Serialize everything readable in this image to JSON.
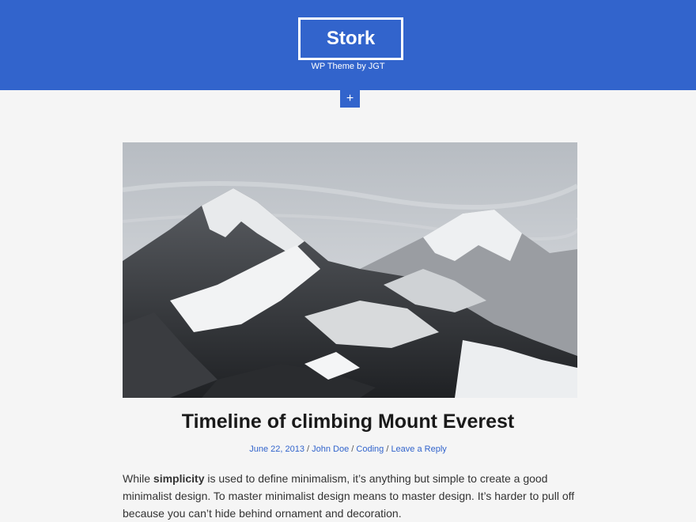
{
  "header": {
    "site_title": "Stork",
    "tagline": "WP Theme by JGT",
    "menu_toggle": "+"
  },
  "post": {
    "image_icon": "mountain-photo",
    "title": "Timeline of climbing Mount Everest",
    "meta": {
      "date": "June 22, 2013",
      "sep1": " / ",
      "author": "John Doe",
      "sep2": " / ",
      "category": "Coding",
      "sep3": " / ",
      "reply": "Leave a Reply"
    },
    "content": {
      "lead": "While ",
      "bold": "simplicity",
      "rest": " is used to define minimalism, it’s anything but simple to create a good minimalist design. To master minimalist design means to master design. It’s harder to pull off because you can’t hide behind ornament and decoration."
    }
  },
  "colors": {
    "brand": "#3264cc",
    "background": "#f5f5f5",
    "title": "#1a1a1a"
  }
}
